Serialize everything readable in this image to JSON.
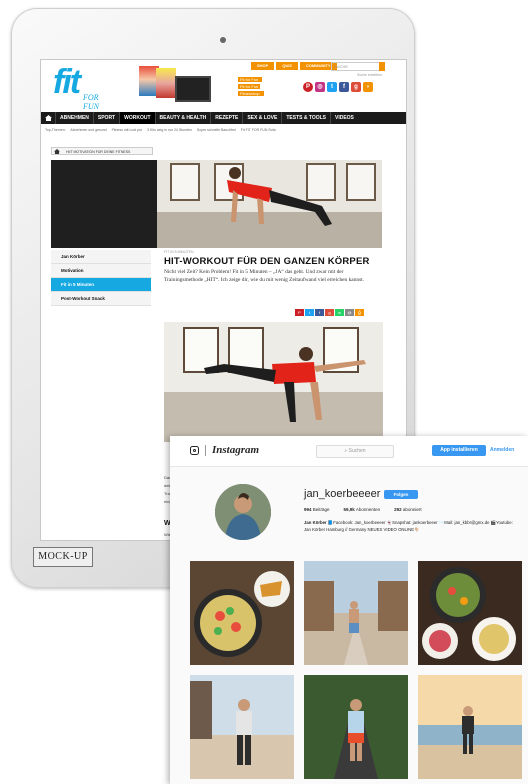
{
  "badge": "MOCK-UP",
  "site": {
    "logo_main": "fit",
    "logo_sub": "FOR FUN",
    "top_buttons": [
      "SHOP",
      "QUIZ",
      "COMMUNITY"
    ],
    "search_placeholder": "SUCHE",
    "search_link": "Suche erweitern",
    "promo_lines": [
      "Fit for Fun",
      "Fit for Fun",
      "Fitnesshop"
    ],
    "nav": [
      "ABNEHMEN",
      "SPORT",
      "WORKOUT",
      "BEAUTY & HEALTH",
      "REZEPTE",
      "SEX & LOVE",
      "TESTS & TOOLS",
      "VIDEOS"
    ],
    "breadcrumb": [
      "Top-Themen:",
      "Abnehmen und gesund",
      "Fitness mit Lust pur",
      "3 Kilo weg in nur 24 Stunden",
      "Super schnelle Bauchfrei",
      "Fit FIT FOR FUN Sofa"
    ],
    "ribbon": "HIIT MOTIVATION FÜR DEINE FITNESS",
    "sidebar": [
      "Jan Körber",
      "Motivation",
      "Fit in 5 Minuten",
      "Post-Workout Snack"
    ],
    "article": {
      "kicker": "FIT IN 5 MINUTEN",
      "headline": "HIT-WORKOUT FÜR DEN GANZEN KÖRPER",
      "intro": "Nicht viel Zeit? Kein Problem! Fit in 5 Minuten – „JA“ das geht. Und zwar mit der Trainingsmethode „HIT“. Ich zeige dir, wie du mit wenig Zeitaufwand viel erreichen kannst.",
      "frag1": "Das eigen",
      "frag2": "deinem Ka",
      "frag3": "Trainingsp",
      "frag4": "eingebaut",
      "frag_heading": "WIE FU",
      "frag5": "Wie die"
    }
  },
  "instagram": {
    "wordmark": "Instagram",
    "search": "Suchen",
    "app_button": "App installieren",
    "login": "Anmelden",
    "username": "jan_koerbeeeer",
    "follow": "Folgen",
    "stats": [
      {
        "value": "994",
        "label": "Beiträge"
      },
      {
        "value": "59,9k",
        "label": "Abonnenten"
      },
      {
        "value": "292",
        "label": "abonniert"
      }
    ],
    "bio_name": "Jan Körber",
    "bio_text": "📘Facebook: Jan_koerbeeeer 👻Snapshat: jankoerbeeer ✉️Mail: jan_kbbr@gmx.de 🎬Youtube: Jan Körber Hamburg // Germany NEUES VIDEO ONLINE👇🏼"
  }
}
